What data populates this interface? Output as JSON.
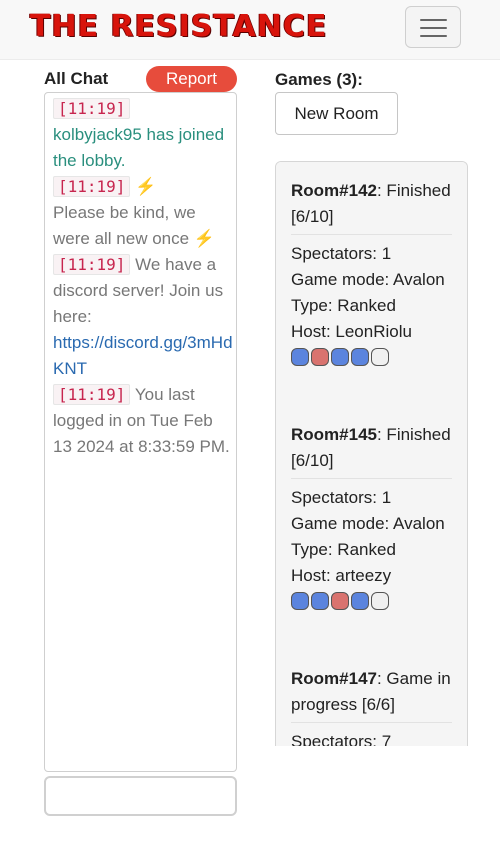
{
  "header": {
    "logo_text": "THE RESISTANCE",
    "menu_icon": "hamburger-icon"
  },
  "chat": {
    "title": "All Chat",
    "report_label": "Report",
    "messages": [
      {
        "time": "[11:19]",
        "text": "kolbyjack95 has joined the lobby."
      },
      {
        "time": "[11:19]",
        "text": "Please be kind, we were all new once"
      },
      {
        "time": "[11:19]",
        "text": "We have a discord server! Join us here:",
        "link": "https://discord.gg/3mHdKNT"
      },
      {
        "time": "[11:19]",
        "text": "You last logged in on Tue Feb 13 2024 at 8:33:59 PM."
      }
    ],
    "input_value": ""
  },
  "games": {
    "title": "Games (3):",
    "new_room_label": "New Room",
    "rooms": [
      {
        "name": "Room#142",
        "status": ": Finished [6/10]",
        "spectators": "Spectators: 1",
        "mode": "Game mode: Avalon",
        "type": "Type: Ranked",
        "host": "Host: LeonRiolu",
        "players": [
          "blue",
          "red",
          "blue",
          "blue",
          "empty"
        ]
      },
      {
        "name": "Room#145",
        "status": ": Finished [6/10]",
        "spectators": "Spectators: 1",
        "mode": "Game mode: Avalon",
        "type": "Type: Ranked",
        "host": "Host: arteezy",
        "players": [
          "blue",
          "blue",
          "red",
          "blue",
          "empty"
        ]
      },
      {
        "name": "Room#147",
        "status": ": Game in progress [6/6]",
        "spectators": "Spectators: 7"
      }
    ]
  },
  "colors": {
    "blue": "#5b84de",
    "red": "#d9736f",
    "empty": "#f0f0f0",
    "report": "#e74c3c"
  }
}
